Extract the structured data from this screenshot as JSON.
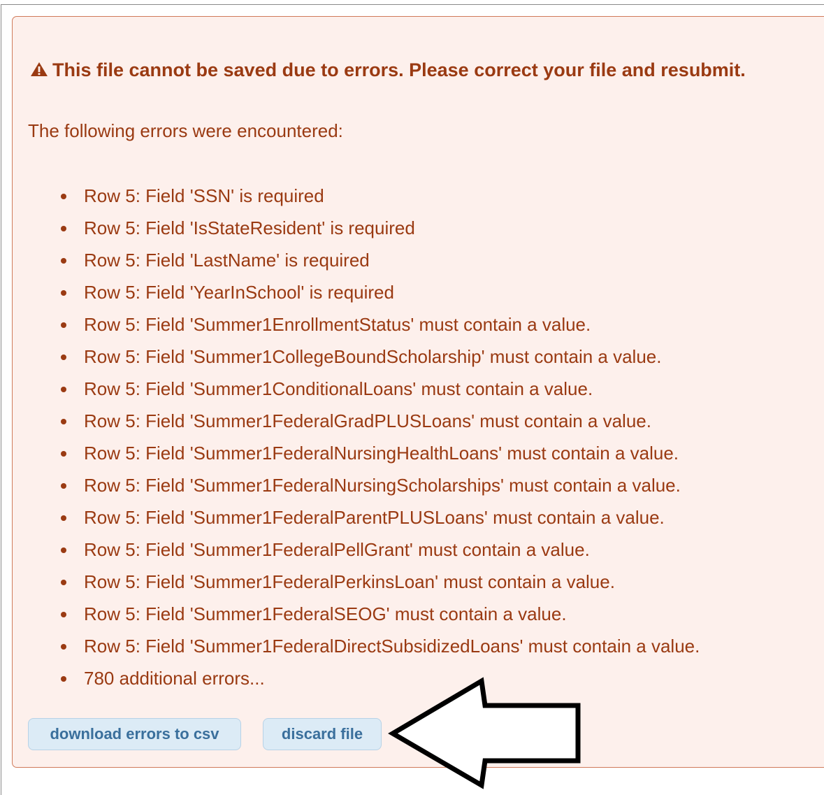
{
  "alert": {
    "heading": "This file cannot be saved due to errors. Please correct your file and resubmit.",
    "intro": "The following errors were encountered:",
    "errors": [
      "Row 5: Field 'SSN' is required",
      "Row 5: Field 'IsStateResident' is required",
      "Row 5: Field 'LastName' is required",
      "Row 5: Field 'YearInSchool' is required",
      "Row 5: Field 'Summer1EnrollmentStatus' must contain a value.",
      "Row 5: Field 'Summer1CollegeBoundScholarship' must contain a value.",
      "Row 5: Field 'Summer1ConditionalLoans' must contain a value.",
      "Row 5: Field 'Summer1FederalGradPLUSLoans' must contain a value.",
      "Row 5: Field 'Summer1FederalNursingHealthLoans' must contain a value.",
      "Row 5: Field 'Summer1FederalNursingScholarships' must contain a value.",
      "Row 5: Field 'Summer1FederalParentPLUSLoans' must contain a value.",
      "Row 5: Field 'Summer1FederalPellGrant' must contain a value.",
      "Row 5: Field 'Summer1FederalPerkinsLoan' must contain a value.",
      "Row 5: Field 'Summer1FederalSEOG' must contain a value.",
      "Row 5: Field 'Summer1FederalDirectSubsidizedLoans' must contain a value.",
      "780 additional errors..."
    ]
  },
  "actions": {
    "download_label": "download errors to csv",
    "discard_label": "discard file"
  },
  "icons": {
    "heading_icon": "warning-triangle-icon",
    "annotation": "arrow-left-icon"
  },
  "colors": {
    "alert_background": "#fdf0ec",
    "alert_border": "#d07a5a",
    "alert_text": "#9a3a12",
    "button_background": "#dcebf6",
    "button_text": "#3a6f9c"
  }
}
